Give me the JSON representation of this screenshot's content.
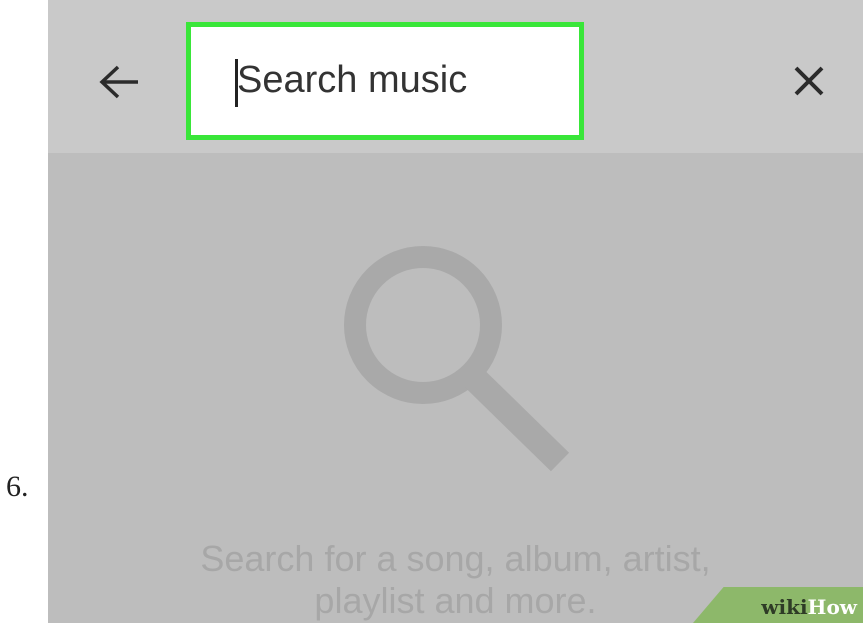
{
  "step": {
    "number": "6."
  },
  "toolbar": {
    "back_icon": "arrow-left-icon",
    "close_icon": "close-icon"
  },
  "search": {
    "placeholder": "Search music",
    "value": "",
    "highlight_color": "#39e639"
  },
  "empty_state": {
    "icon": "magnifier-icon",
    "line1": "Search for a song, album, artist,",
    "line2": "playlist and more."
  },
  "watermark": {
    "part1": "wiki",
    "part2": "How"
  },
  "colors": {
    "top_bar": "#c9c9c9",
    "body": "#bdbdbd",
    "hint_text": "#a7a7a7"
  }
}
